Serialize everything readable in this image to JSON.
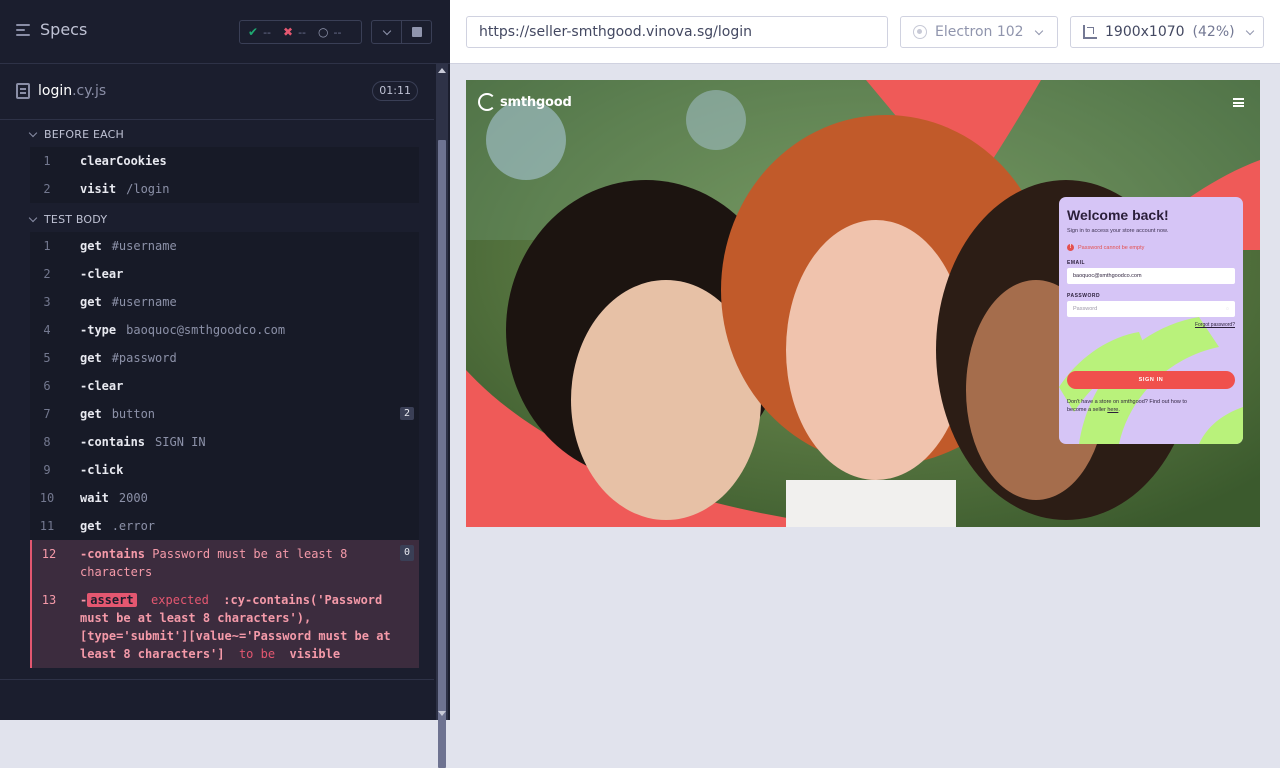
{
  "reporter": {
    "specs_label": "Specs",
    "stats": {
      "passed": "--",
      "failed": "--",
      "pending": "--"
    },
    "spec": {
      "name": "login",
      "ext": ".cy.js",
      "duration": "01:11"
    },
    "before_each": {
      "title": "BEFORE EACH",
      "commands": [
        {
          "num": "1",
          "name": "clearCookies",
          "msg": ""
        },
        {
          "num": "2",
          "name": "visit",
          "msg": "/login"
        }
      ]
    },
    "test_body": {
      "title": "TEST BODY",
      "commands": [
        {
          "num": "1",
          "name": "get",
          "msg": "#username"
        },
        {
          "num": "2",
          "name": "-clear",
          "msg": ""
        },
        {
          "num": "3",
          "name": "get",
          "msg": "#username"
        },
        {
          "num": "4",
          "name": "-type",
          "msg": "baoquoc@smthgoodco.com"
        },
        {
          "num": "5",
          "name": "get",
          "msg": "#password"
        },
        {
          "num": "6",
          "name": "-clear",
          "msg": ""
        },
        {
          "num": "7",
          "name": "get",
          "msg": "button",
          "badge": "2"
        },
        {
          "num": "8",
          "name": "-contains",
          "msg": "SIGN IN"
        },
        {
          "num": "9",
          "name": "-click",
          "msg": ""
        },
        {
          "num": "10",
          "name": "wait",
          "msg": "2000"
        },
        {
          "num": "11",
          "name": "get",
          "msg": ".error"
        }
      ],
      "failed": [
        {
          "num": "12",
          "name": "-contains",
          "msg": "Password must be at least 8 characters",
          "badge": "0"
        },
        {
          "num": "13",
          "assert_label": "assert",
          "expected": "expected",
          "subject": ":cy-contains('Password must be at least 8 characters'), [type='submit'][value~='Password must be at least 8 characters']",
          "to_be": "to be",
          "state": "visible"
        }
      ]
    }
  },
  "aut": {
    "url": "https://seller-smthgood.vinova.sg/login",
    "browser": "Electron 102",
    "viewport": "1900x1070",
    "zoom": "(42%)"
  },
  "site": {
    "logo_text": "smthgood",
    "card": {
      "title": "Welcome back!",
      "subtitle": "Sign in to access your store account now.",
      "error": "Password cannot be empty",
      "email_label": "EMAIL",
      "email_value": "baoquoc@smthgoodco.com",
      "password_label": "PASSWORD",
      "password_placeholder": "Password",
      "forgot": "Forgot password?",
      "sign_in": "SIGN IN",
      "footer": "Don't have a store on smthgood? Find out how to become a seller",
      "footer_link": "here"
    }
  },
  "colors": {
    "accent": "#f0504d",
    "card_bg": "#d6c5f6",
    "fail": "#e45770",
    "pass": "#1fa971"
  }
}
